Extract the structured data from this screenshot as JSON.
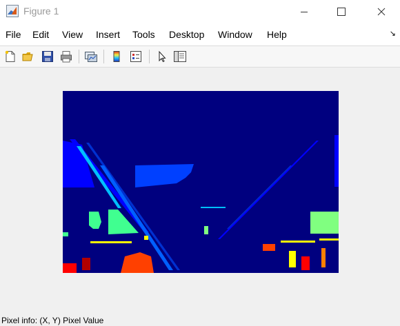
{
  "window": {
    "title": "Figure 1"
  },
  "menu": {
    "items": [
      "File",
      "Edit",
      "View",
      "Insert",
      "Tools",
      "Desktop",
      "Window",
      "Help"
    ],
    "dock_arrow": "↘"
  },
  "toolbar": {
    "buttons": [
      "new-figure",
      "open-file",
      "save",
      "print",
      "link-plot",
      "insert-colorbar",
      "insert-legend",
      "edit-plot",
      "open-property-inspector"
    ]
  },
  "figure": {
    "content": "jet-colormap-labeled-image",
    "colors": {
      "background": "#00007f",
      "blue": "#0000ff",
      "mid_blue": "#0040ff",
      "cyan": "#00c0ff",
      "light_green": "#80ff80",
      "green": "#40ff90",
      "yellow": "#ffff00",
      "orange": "#ff4000",
      "red": "#ff0000",
      "dark_red": "#b00000"
    }
  },
  "status": {
    "text": "Pixel info: (X, Y)  Pixel Value"
  }
}
